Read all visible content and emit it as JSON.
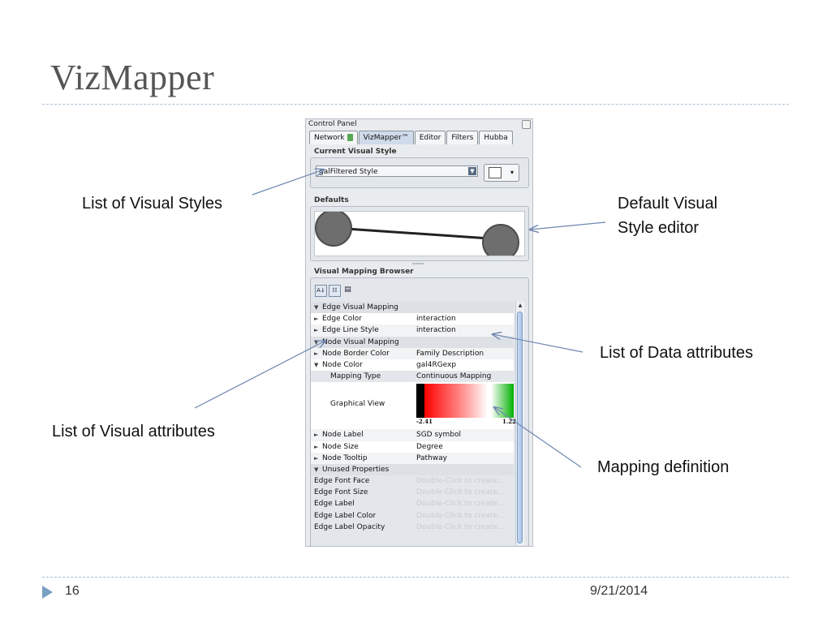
{
  "slide": {
    "title": "VizMapper",
    "page_number": "16",
    "date": "9/21/2014"
  },
  "callouts": {
    "visual_styles": "List of Visual Styles",
    "default_editor_line1": "Default Visual",
    "default_editor_line2": "Style editor",
    "data_attributes": "List of Data attributes",
    "visual_attributes": "List of Visual attributes",
    "mapping_definition": "Mapping definition"
  },
  "panel": {
    "title": "Control Panel",
    "tabs": [
      "Network",
      "VizMapper™",
      "Editor",
      "Filters",
      "Hubba"
    ],
    "current_style_label": "Current Visual Style",
    "current_style_value": "galFiltered Style",
    "defaults_label": "Defaults",
    "browser_label": "Visual Mapping Browser"
  },
  "mapping_rows": [
    {
      "kind": "hdr",
      "expand": "▼",
      "name": "Edge Visual Mapping",
      "value": ""
    },
    {
      "kind": "prop",
      "expand": "►",
      "name": "Edge Color",
      "value": "interaction"
    },
    {
      "kind": "prop",
      "expand": "►",
      "name": "Edge Line Style",
      "value": "interaction"
    },
    {
      "kind": "hdr",
      "expand": "▼",
      "name": "Node Visual Mapping",
      "value": ""
    },
    {
      "kind": "prop",
      "expand": "►",
      "name": "Node Border Color",
      "value": "Family Description"
    },
    {
      "kind": "prop",
      "expand": "▼",
      "name": "Node Color",
      "value": "gal4RGexp"
    },
    {
      "kind": "sub",
      "expand": "",
      "name": "Mapping Type",
      "value": "Continuous Mapping"
    }
  ],
  "graphical_view": {
    "label": "Graphical View",
    "min": "-2.41",
    "max": "1.22"
  },
  "mapping_rows_after": [
    {
      "kind": "prop",
      "expand": "►",
      "name": "Node Label",
      "value": "SGD symbol"
    },
    {
      "kind": "prop",
      "expand": "►",
      "name": "Node Size",
      "value": "Degree"
    },
    {
      "kind": "prop",
      "expand": "►",
      "name": "Node Tooltip",
      "value": "Pathway"
    },
    {
      "kind": "hdr",
      "expand": "▼",
      "name": "Unused Properties",
      "value": ""
    },
    {
      "kind": "unused",
      "expand": "",
      "name": "Edge Font Face",
      "value": "Double-Click to create..."
    },
    {
      "kind": "unused",
      "expand": "",
      "name": "Edge Font Size",
      "value": "Double-Click to create..."
    },
    {
      "kind": "unused",
      "expand": "",
      "name": "Edge Label",
      "value": "Double-Click to create..."
    },
    {
      "kind": "unused",
      "expand": "",
      "name": "Edge Label Color",
      "value": "Double-Click to create..."
    },
    {
      "kind": "unused",
      "expand": "",
      "name": "Edge Label Opacity",
      "value": "Double-Click to create..."
    }
  ],
  "colors": {
    "title": "#555555",
    "divider": "#a9bfd4",
    "arrow": "#6f87b0",
    "accent_triangle": "#7a9fc4"
  }
}
